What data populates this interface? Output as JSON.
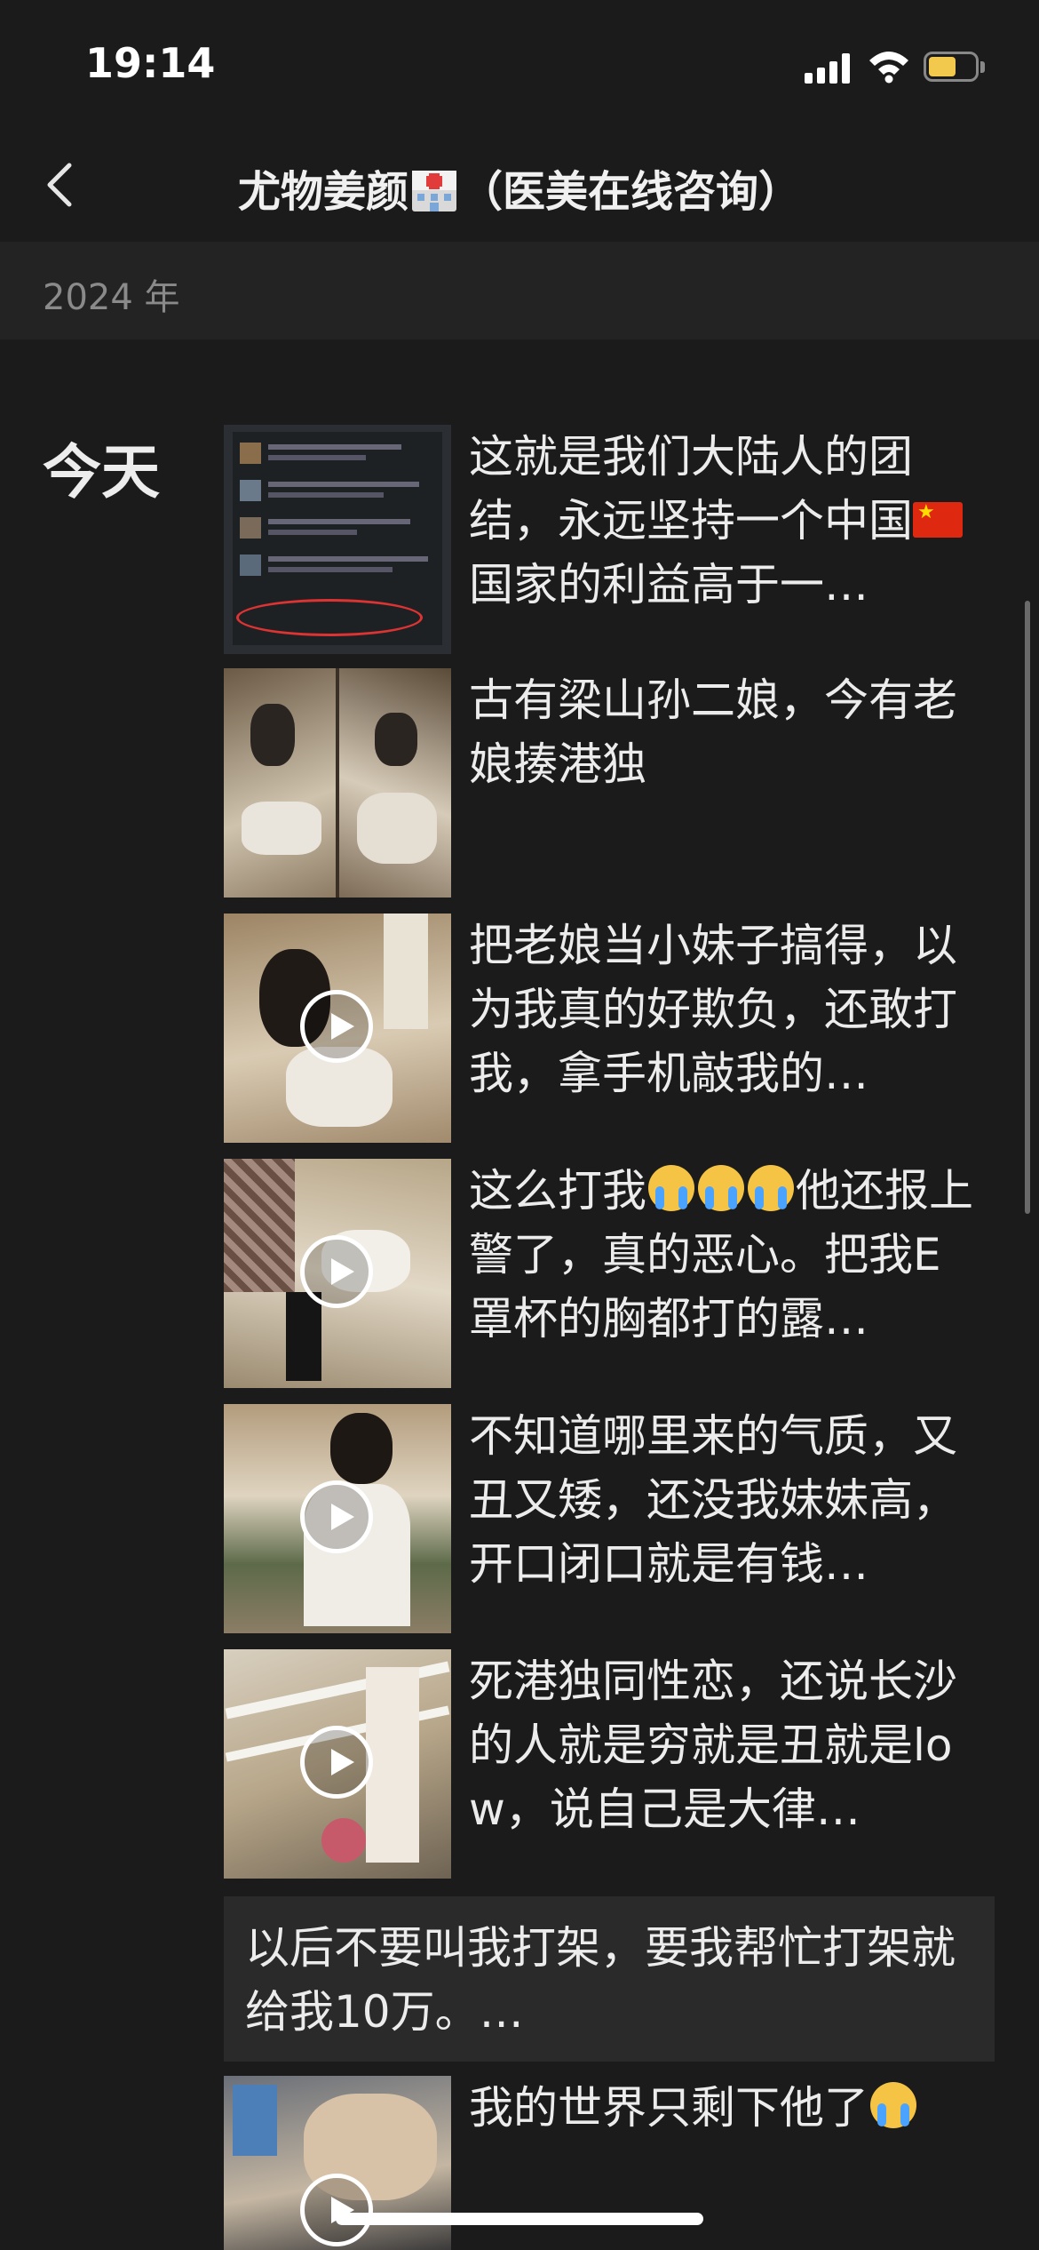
{
  "status_bar": {
    "time": "19:14"
  },
  "nav": {
    "title_prefix": "尤物姜颜",
    "title_suffix": "（医美在线咨询）"
  },
  "timeline": {
    "year": "2024 年",
    "day": "今天",
    "posts": [
      {
        "caption": "这就是我们大陆人的团结，永远坚持一个中国 国家的利益高于一…",
        "is_video": false,
        "flag_emoji": true
      },
      {
        "caption": "古有梁山孙二娘，今有老娘揍港独",
        "is_video": false
      },
      {
        "caption": "把老娘当小妹子搞得，以为我真的好欺负，还敢打我，拿手机敲我的…",
        "is_video": true
      },
      {
        "caption": "这么打我",
        "caption_after_emoji": "他还报上警了，真的恶心。把我E罩杯的胸都打的露…",
        "is_video": true,
        "crying_emoji_count": 3
      },
      {
        "caption": "不知道哪里来的气质，又丑又矮，还没我妹妹高，开口闭口就是有钱…",
        "is_video": true
      },
      {
        "caption": "死港独同性恋，还说长沙的人就是穷就是丑就是low，说自己是大律…",
        "is_video": true
      },
      {
        "caption": "我的世界只剩下他了",
        "is_video": true,
        "crying_emoji_count": 1
      }
    ],
    "text_post": {
      "caption": "以后不要叫我打架，要我帮忙打架就给我10万。…"
    }
  }
}
